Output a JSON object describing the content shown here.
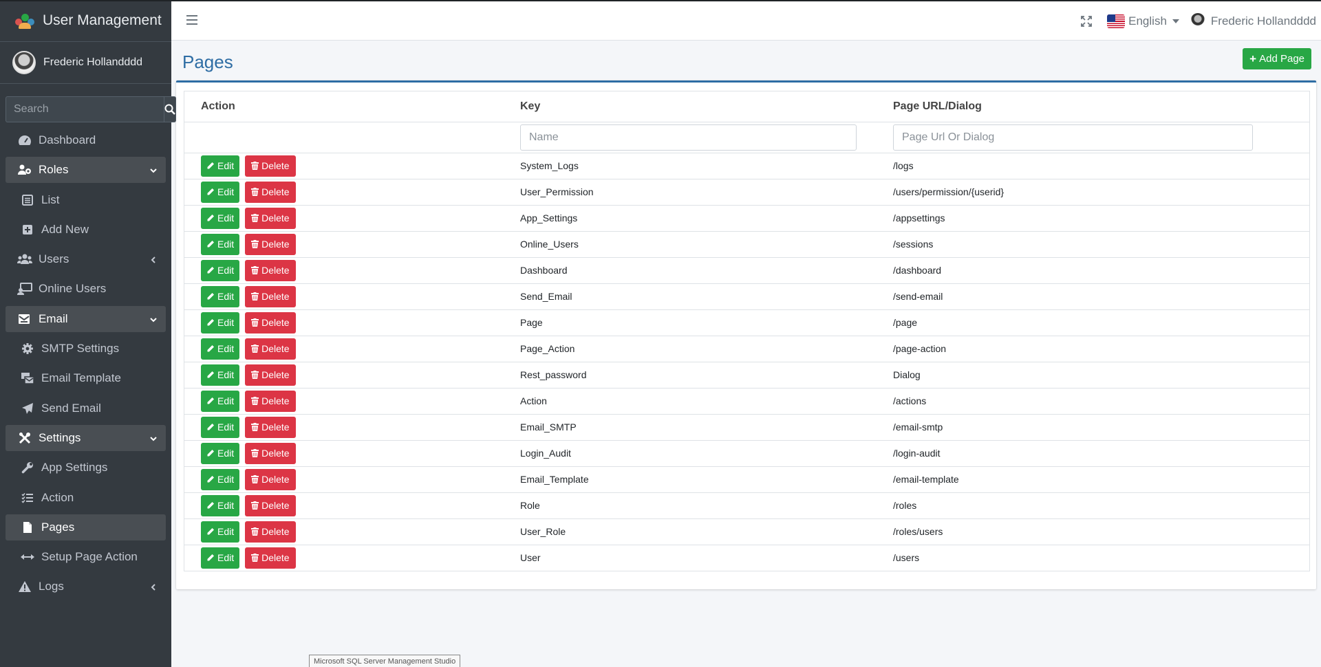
{
  "app": {
    "title": "User Management"
  },
  "sidebar": {
    "user_name": "Frederic Hollandddd",
    "search_placeholder": "Search",
    "items": [
      {
        "label": "Dashboard",
        "icon": "gauge-icon"
      },
      {
        "label": "Roles",
        "icon": "users-cog-icon"
      },
      {
        "label": "List",
        "icon": "list-icon"
      },
      {
        "label": "Add New",
        "icon": "plus-square-icon"
      },
      {
        "label": "Users",
        "icon": "users-icon"
      },
      {
        "label": "Online Users",
        "icon": "online-users-icon"
      },
      {
        "label": "Email",
        "icon": "mail-bulk-icon"
      },
      {
        "label": "SMTP Settings",
        "icon": "gear-icon"
      },
      {
        "label": "Email Template",
        "icon": "mail-template-icon"
      },
      {
        "label": "Send Email",
        "icon": "paper-plane-icon"
      },
      {
        "label": "Settings",
        "icon": "tools-icon"
      },
      {
        "label": "App Settings",
        "icon": "wrench-icon"
      },
      {
        "label": "Action",
        "icon": "tasks-icon"
      },
      {
        "label": "Pages",
        "icon": "file-icon"
      },
      {
        "label": "Setup Page Action",
        "icon": "arrows-h-icon"
      },
      {
        "label": "Logs",
        "icon": "warning-icon"
      }
    ]
  },
  "topbar": {
    "language": "English",
    "user_name": "Frederic Hollandddd"
  },
  "page": {
    "title": "Pages",
    "add_label": "Add Page"
  },
  "table": {
    "headers": {
      "action": "Action",
      "key": "Key",
      "url": "Page URL/Dialog"
    },
    "filters": {
      "key_placeholder": "Name",
      "url_placeholder": "Page Url Or Dialog"
    },
    "edit_label": "Edit",
    "delete_label": "Delete",
    "rows": [
      {
        "key": "System_Logs",
        "url": "/logs"
      },
      {
        "key": "User_Permission",
        "url": "/users/permission/{userid}"
      },
      {
        "key": "App_Settings",
        "url": "/appsettings"
      },
      {
        "key": "Online_Users",
        "url": "/sessions"
      },
      {
        "key": "Dashboard",
        "url": "/dashboard"
      },
      {
        "key": "Send_Email",
        "url": "/send-email"
      },
      {
        "key": "Page",
        "url": "/page"
      },
      {
        "key": "Page_Action",
        "url": "/page-action"
      },
      {
        "key": "Rest_password",
        "url": "Dialog"
      },
      {
        "key": "Action",
        "url": "/actions"
      },
      {
        "key": "Email_SMTP",
        "url": "/email-smtp"
      },
      {
        "key": "Login_Audit",
        "url": "/login-audit"
      },
      {
        "key": "Email_Template",
        "url": "/email-template"
      },
      {
        "key": "Role",
        "url": "/roles"
      },
      {
        "key": "User_Role",
        "url": "/roles/users"
      },
      {
        "key": "User",
        "url": "/users"
      }
    ]
  },
  "taskbar_tooltip": "Microsoft SQL Server Management Studio"
}
